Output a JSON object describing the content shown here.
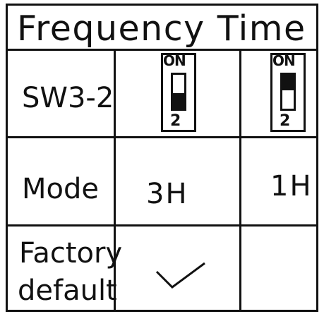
{
  "title": "Frequency Time",
  "rows": {
    "switch": {
      "label": "SW3-2"
    },
    "mode": {
      "label": "Mode",
      "values": [
        "3H",
        "1H"
      ]
    },
    "factory": {
      "label_line1": "Factory",
      "label_line2": "default"
    }
  },
  "dip_switches": [
    {
      "on_text": "ON",
      "number": "2",
      "position": "down"
    },
    {
      "on_text": "ON",
      "number": "2",
      "position": "up"
    }
  ],
  "factory_default_column": 1,
  "icons": {
    "check": "check-icon",
    "dip": "dip-switch-icon"
  }
}
